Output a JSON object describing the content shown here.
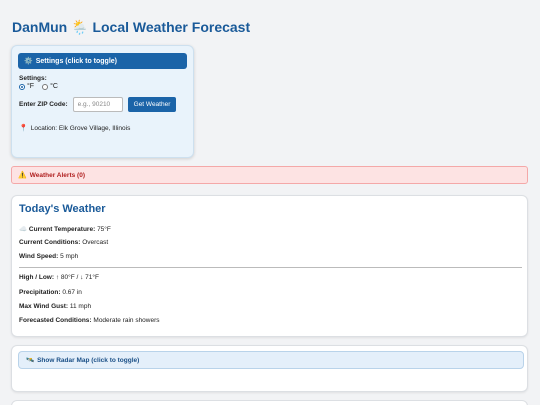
{
  "app": {
    "name": "DanMun",
    "title_icon": "sun-behind-rain-cloud-icon",
    "title_suffix": "Local Weather Forecast"
  },
  "settings": {
    "toggle_label": "Settings (click to toggle)",
    "toggle_icon": "gear-icon",
    "label": "Settings:",
    "units": [
      {
        "label": "°F",
        "checked": true
      },
      {
        "label": "°C",
        "checked": false
      }
    ],
    "zip_label": "Enter ZIP Code:",
    "zip_value": "",
    "zip_placeholder": "e.g., 90210",
    "get_button": "Get Weather",
    "location": "Location: Elk Grove Village, Illinois"
  },
  "alerts": {
    "label": "Weather Alerts (0)",
    "icon": "warning-icon"
  },
  "today": {
    "title": "Today's Weather",
    "temp_label": "Current Temperature:",
    "temp_value": "75°F",
    "conditions_label": "Current Conditions:",
    "conditions_value": "Overcast",
    "wind_label": "Wind Speed:",
    "wind_value": "5 mph",
    "highlow_label": "High / Low:",
    "highlow_value": "↑ 80°F / ↓ 71°F",
    "precip_label": "Precipitation:",
    "precip_value": "0.67 in",
    "gust_label": "Max Wind Gust:",
    "gust_value": "11 mph",
    "forecast_label": "Forecasted Conditions:",
    "forecast_value": "Moderate rain showers"
  },
  "radar": {
    "toggle_label": "Show Radar Map (click to toggle)",
    "icon": "satellite-icon"
  },
  "colors": {
    "accent": "#1b64a8",
    "title": "#1a5a99",
    "alert_bg": "#fde3e3",
    "alert_text": "#b01f1f"
  }
}
